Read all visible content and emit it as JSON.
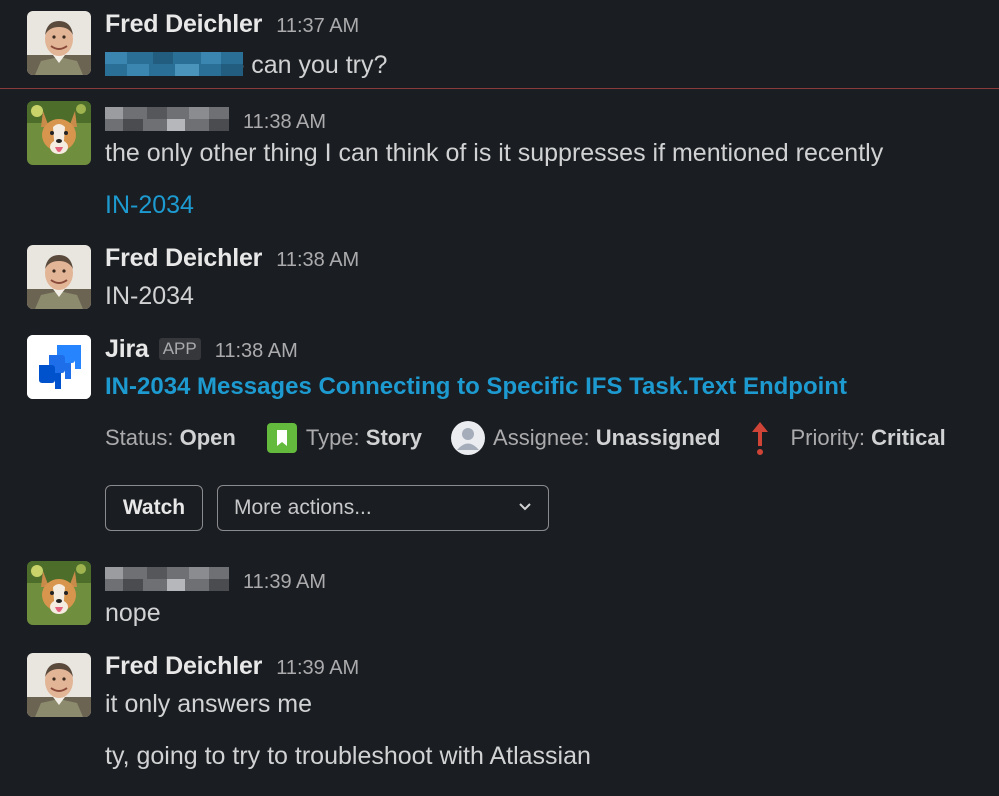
{
  "messages": [
    {
      "author": "Fred Deichler",
      "time": "11:37 AM",
      "text": " - can you try?"
    },
    {
      "author": "",
      "time": "11:38 AM",
      "text": "the only other thing I can think of is it suppresses if mentioned recently",
      "link": "IN-2034"
    },
    {
      "author": "Fred Deichler",
      "time": "11:38 AM",
      "text": "IN-2034"
    },
    {
      "author": "Jira",
      "badge": "APP",
      "time": "11:38 AM"
    },
    {
      "author": "",
      "time": "11:39 AM",
      "text": "nope"
    },
    {
      "author": "Fred Deichler",
      "time": "11:39 AM",
      "text": "it only answers me",
      "text2": "ty, going to try to troubleshoot with Atlassian"
    }
  ],
  "jira_card": {
    "title": "IN-2034 Messages Connecting to Specific IFS Task.Text Endpoint",
    "status_label": "Status:",
    "status_value": "Open",
    "type_label": "Type:",
    "type_value": "Story",
    "assignee_label": "Assignee:",
    "assignee_value": "Unassigned",
    "priority_label": "Priority:",
    "priority_value": "Critical",
    "watch_button": "Watch",
    "more_actions": "More actions...",
    "type_icon_color": "#63ba3c",
    "priority_icon_color": "#d04437"
  },
  "colors": {
    "background": "#1a1d21",
    "link": "#1d9bd1",
    "new_divider": "#8a3a3a"
  }
}
